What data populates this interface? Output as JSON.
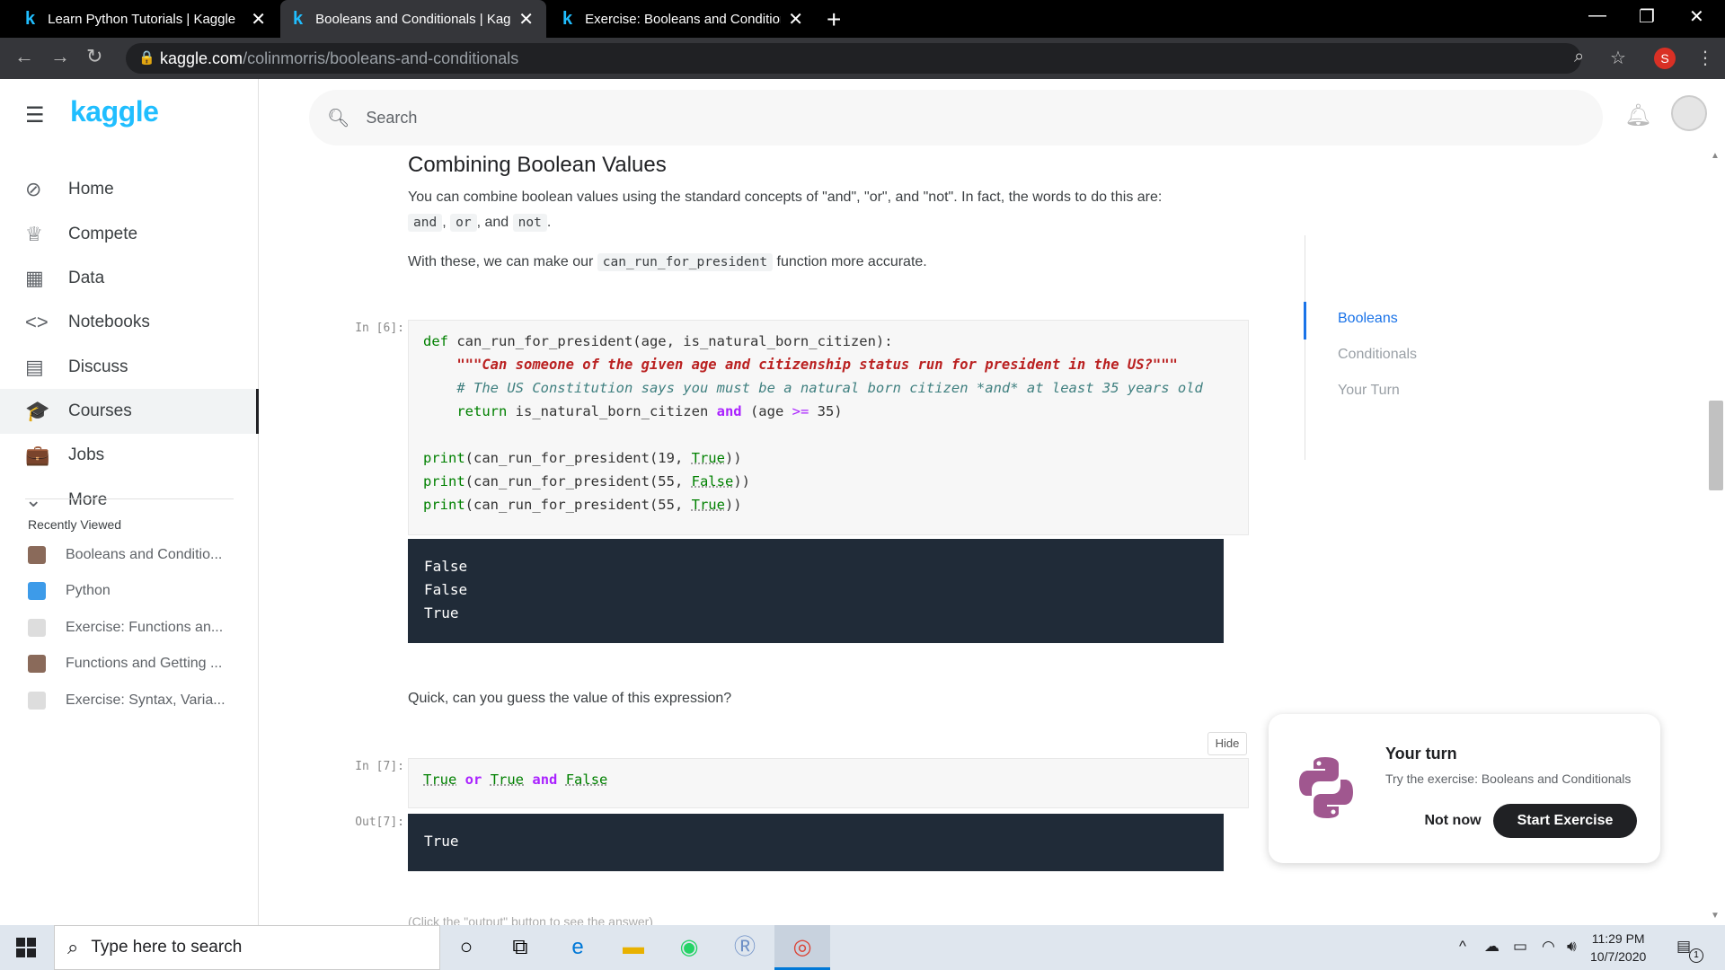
{
  "browser": {
    "tabs": [
      {
        "title": "Learn Python Tutorials | Kaggle"
      },
      {
        "title": "Booleans and Conditionals | Kaggle"
      },
      {
        "title": "Exercise: Booleans and Conditionals"
      }
    ],
    "url_host": "kaggle.com",
    "url_path": "/colinmorris/booleans-and-conditionals",
    "profile_initial": "S"
  },
  "sidebar": {
    "logo": "kaggle",
    "nav": [
      {
        "label": "Home",
        "icon": "compass-icon"
      },
      {
        "label": "Compete",
        "icon": "trophy-icon"
      },
      {
        "label": "Data",
        "icon": "table-icon"
      },
      {
        "label": "Notebooks",
        "icon": "code-icon"
      },
      {
        "label": "Discuss",
        "icon": "comment-icon"
      },
      {
        "label": "Courses",
        "icon": "graduation-cap-icon"
      },
      {
        "label": "Jobs",
        "icon": "briefcase-icon"
      },
      {
        "label": "More",
        "icon": "chevron-down-icon"
      }
    ],
    "recent_title": "Recently Viewed",
    "recent": [
      {
        "label": "Booleans and Conditio..."
      },
      {
        "label": "Python"
      },
      {
        "label": "Exercise: Functions an..."
      },
      {
        "label": "Functions and Getting ..."
      },
      {
        "label": "Exercise: Syntax, Varia..."
      }
    ]
  },
  "header": {
    "search_placeholder": "Search"
  },
  "content": {
    "section_title": "Combining Boolean Values",
    "para1_a": "You can combine boolean values using the standard concepts of \"and\", \"or\", and \"not\". In fact, the words to do this are:",
    "kw_and": "and",
    "kw_or": "or",
    "kw_not": "not",
    "para1_sep1": ",",
    "para1_sep2": ", and",
    "para1_end": ".",
    "para2_a": "With these, we can make our",
    "para2_code": "can_run_for_president",
    "para2_b": "function more accurate.",
    "cell6_prompt": "In [6]:",
    "cell6_output": [
      "False",
      "False",
      "True"
    ],
    "question": "Quick, can you guess the value of this expression?",
    "hide_label": "Hide",
    "cell7_prompt": "In [7]:",
    "out7_prompt": "Out[7]:",
    "cell7_output": "True",
    "cutoff_text": "(Click the \"output\" button to see the answer)"
  },
  "toc": {
    "items": [
      {
        "label": "Booleans"
      },
      {
        "label": "Conditionals"
      },
      {
        "label": "Your Turn"
      }
    ]
  },
  "card": {
    "title": "Your turn",
    "subtitle": "Try the exercise: Booleans and Conditionals",
    "not_now": "Not now",
    "start": "Start Exercise"
  },
  "taskbar": {
    "search_placeholder": "Type here to search",
    "time": "11:29 PM",
    "date": "10/7/2020",
    "notification_count": "1"
  },
  "colors": {
    "kaggle_blue": "#20beff",
    "toc_active": "#1a73e8",
    "output_bg": "#202b38"
  }
}
